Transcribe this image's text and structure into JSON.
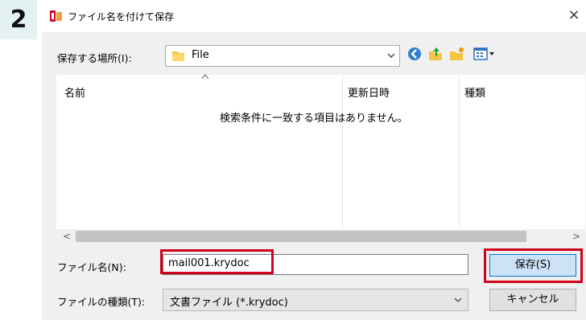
{
  "step_number": "2",
  "dialog": {
    "title": "ファイル名を付けて保存",
    "close_glyph": "×",
    "location_label": "保存する場所(I):",
    "location_value": "File",
    "toolbar_icons": [
      "back-icon",
      "up-folder-icon",
      "new-folder-icon",
      "view-menu-icon"
    ]
  },
  "filelist": {
    "columns": [
      "名前",
      "更新日時",
      "種類"
    ],
    "empty_message": "検索条件に一致する項目はありません。",
    "scroll_left": "<",
    "scroll_right": ">"
  },
  "filename": {
    "label": "ファイル名(N):",
    "value": "mail001.krydoc"
  },
  "filetype": {
    "label": "ファイルの種類(T):",
    "selected": "文書ファイル (*.krydoc)"
  },
  "buttons": {
    "save": "保存(S)",
    "cancel": "キャンセル"
  },
  "colors": {
    "highlight": "#d0021b",
    "step_bg": "#e3f1f1",
    "save_button_bg": "#cde2f7"
  }
}
